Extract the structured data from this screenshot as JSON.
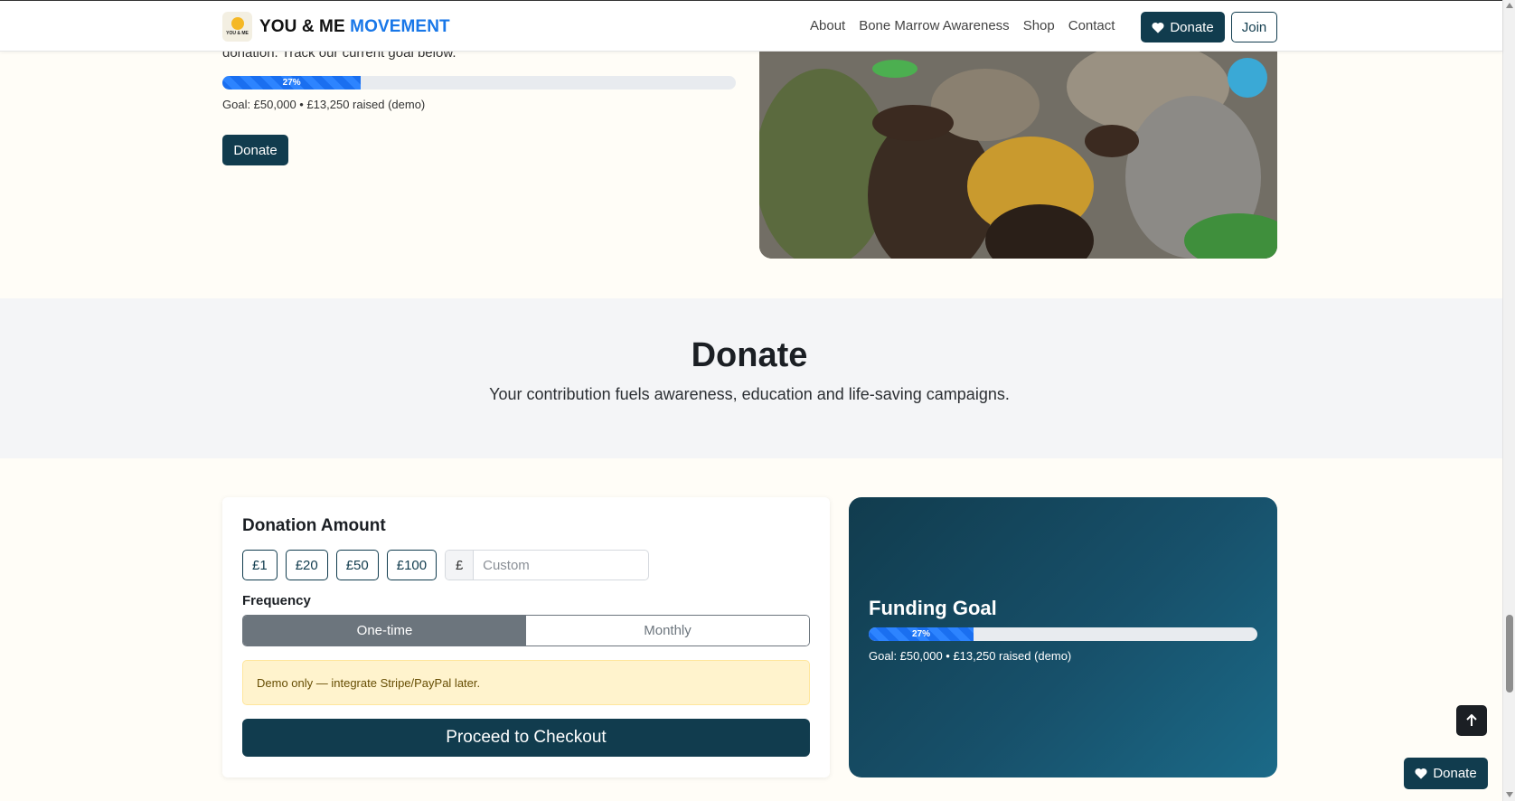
{
  "navbar": {
    "brand_prefix": "YOU & ME",
    "brand_accent": "MOVEMENT",
    "logo_text": "YOU & ME",
    "links": [
      "About",
      "Bone Marrow Awareness",
      "Shop",
      "Contact"
    ],
    "donate_label": "Donate",
    "join_label": "Join"
  },
  "hero": {
    "text": "donation. Track our current goal below.",
    "progress_percent": 27,
    "progress_label": "27%",
    "goal_text": "Goal: £50,000 • £13,250 raised (demo)",
    "donate_label": "Donate"
  },
  "donate_section": {
    "title": "Donate",
    "subtitle": "Your contribution fuels awareness, education and life-saving campaigns."
  },
  "donation_card": {
    "title": "Donation Amount",
    "amounts": [
      "£1",
      "£20",
      "£50",
      "£100"
    ],
    "currency_symbol": "£",
    "custom_placeholder": "Custom",
    "frequency_label": "Frequency",
    "frequency_options": [
      "One-time",
      "Monthly"
    ],
    "frequency_selected": "One-time",
    "alert_text": "Demo only — integrate Stripe/PayPal later.",
    "checkout_label": "Proceed to Checkout"
  },
  "funding_card": {
    "title": "Funding Goal",
    "progress_percent": 27,
    "progress_label": "27%",
    "goal_text": "Goal: £50,000 • £13,250 raised (demo)"
  },
  "floating": {
    "donate_label": "Donate"
  },
  "colors": {
    "primary": "#113c4e",
    "accent": "#1877e8",
    "progress": "#1a6ff0",
    "page_bg": "#fffdf7",
    "alert_bg": "#fff3cd"
  }
}
